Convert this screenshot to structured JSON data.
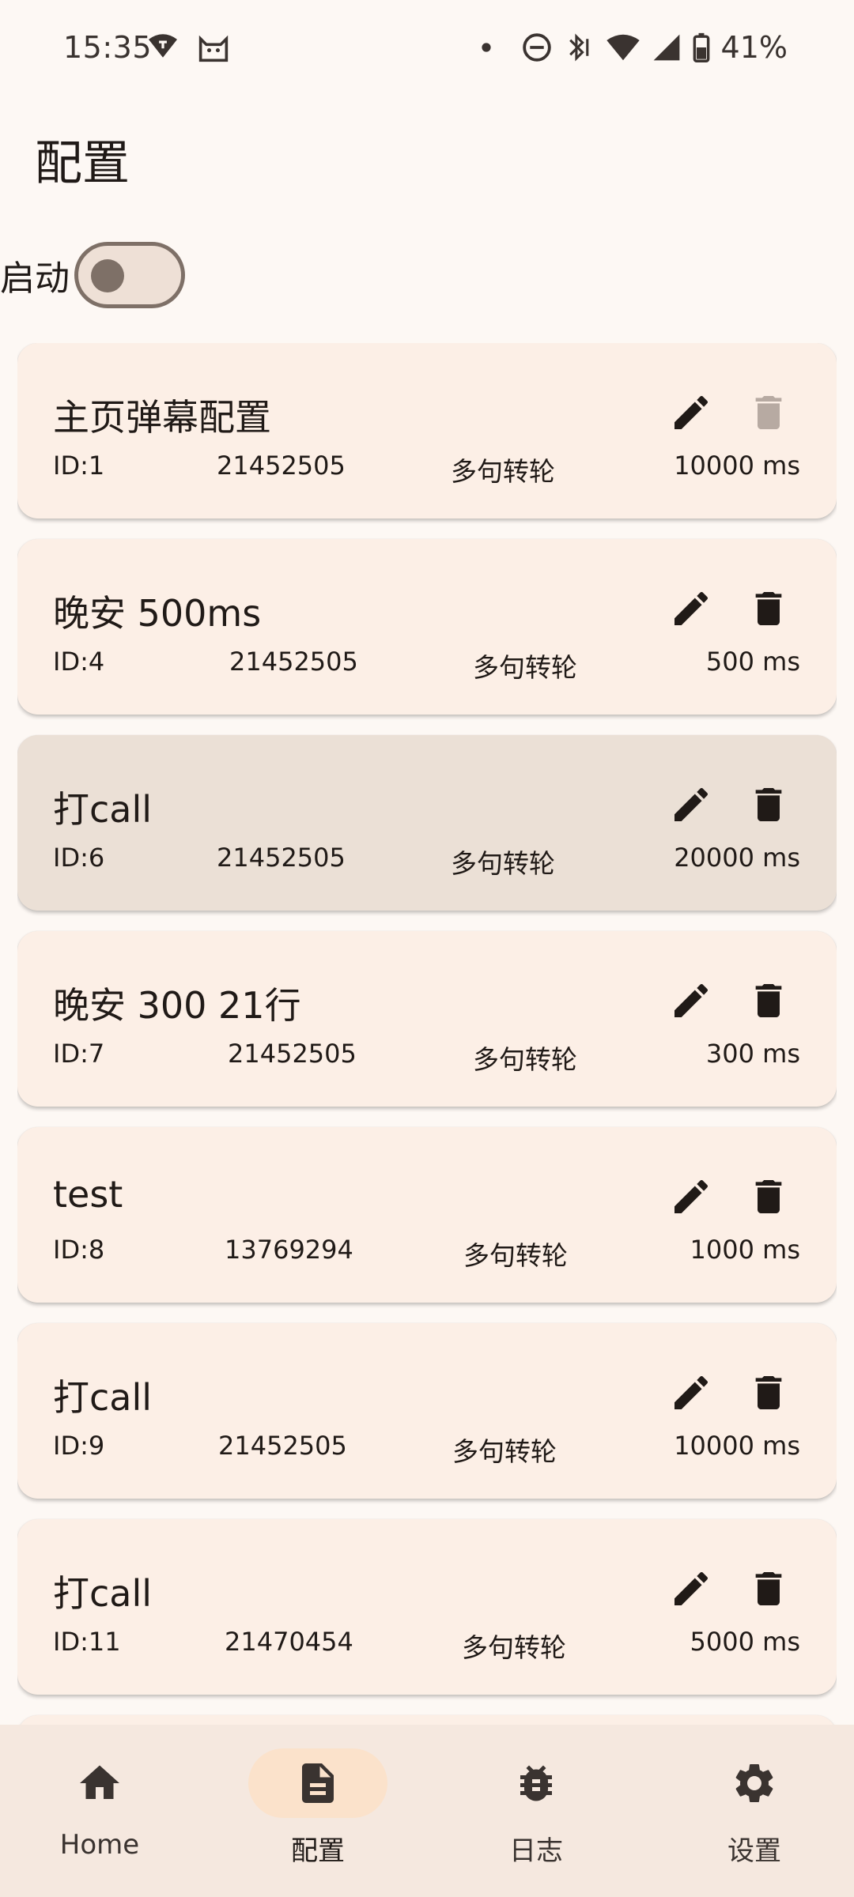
{
  "status_bar": {
    "time": "15:35",
    "battery": "41%"
  },
  "page": {
    "title": "配置"
  },
  "toggle": {
    "label": "启动",
    "on": false
  },
  "colors": {
    "background": "#fdf8f4",
    "card": "#fcefe6",
    "card_selected": "#ebe0d6",
    "nav_bar": "#f5e8df",
    "nav_active_pill": "#fbe2cb",
    "delete_disabled": "#b7aaa2"
  },
  "configs": [
    {
      "title": "主页弹幕配置",
      "id": "ID:1",
      "room": "21452505",
      "mode": "多句转轮",
      "interval": "10000 ms",
      "delete_enabled": false
    },
    {
      "title": "晚安 500ms",
      "id": "ID:4",
      "room": "21452505",
      "mode": "多句转轮",
      "interval": "500 ms",
      "delete_enabled": true
    },
    {
      "title": "打call",
      "id": "ID:6",
      "room": "21452505",
      "mode": "多句转轮",
      "interval": "20000 ms",
      "delete_enabled": true,
      "selected": true
    },
    {
      "title": "晚安 300 21行",
      "id": "ID:7",
      "room": "21452505",
      "mode": "多句转轮",
      "interval": "300 ms",
      "delete_enabled": true
    },
    {
      "title": "test",
      "id": "ID:8",
      "room": "13769294",
      "mode": "多句转轮",
      "interval": "1000 ms",
      "delete_enabled": true
    },
    {
      "title": "打call",
      "id": "ID:9",
      "room": "21452505",
      "mode": "多句转轮",
      "interval": "10000 ms",
      "delete_enabled": true
    },
    {
      "title": "打call",
      "id": "ID:11",
      "room": "21470454",
      "mode": "多句转轮",
      "interval": "5000 ms",
      "delete_enabled": true
    }
  ],
  "icons": {
    "edit": "pencil-icon",
    "delete": "trash-icon"
  },
  "nav": {
    "items": [
      {
        "label": "Home",
        "icon": "home-icon"
      },
      {
        "label": "配置",
        "icon": "document-icon",
        "active": true
      },
      {
        "label": "日志",
        "icon": "bug-icon"
      },
      {
        "label": "设置",
        "icon": "gear-icon"
      }
    ]
  }
}
